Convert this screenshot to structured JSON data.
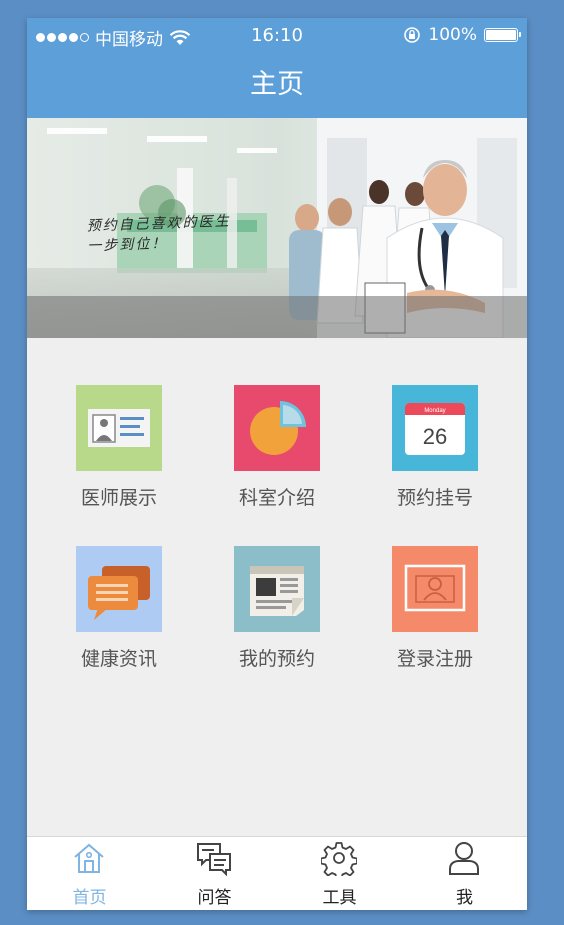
{
  "status_bar": {
    "carrier": "中国移动",
    "time": "16:10",
    "battery": "100%",
    "battery_level": 1.0,
    "signal_bars_filled": 4,
    "signal_bars_total": 5
  },
  "nav": {
    "title": "主页"
  },
  "banner": {
    "caption_line1": "预约自己喜欢的医生",
    "caption_line2": "一步到位！"
  },
  "grid": {
    "items": [
      {
        "label": "医师展示",
        "icon": "doctor-card-icon",
        "color": "#b9d98a"
      },
      {
        "label": "科室介绍",
        "icon": "pie-chart-icon",
        "color": "#e74a6d"
      },
      {
        "label": "预约挂号",
        "icon": "calendar-icon",
        "color": "#48b6d8",
        "calendar_month": "Monday",
        "calendar_day": "26"
      },
      {
        "label": "健康资讯",
        "icon": "chat-bubbles-icon",
        "color": "#aecbf4"
      },
      {
        "label": "我的预约",
        "icon": "newspaper-icon",
        "color": "#8cbec9"
      },
      {
        "label": "登录注册",
        "icon": "user-frame-icon",
        "color": "#f58a6a"
      }
    ]
  },
  "tabs": [
    {
      "label": "首页",
      "icon": "home-icon",
      "active": true
    },
    {
      "label": "问答",
      "icon": "qa-icon",
      "active": false
    },
    {
      "label": "工具",
      "icon": "gear-icon",
      "active": false
    },
    {
      "label": "我",
      "icon": "user-icon",
      "active": false
    }
  ],
  "colors": {
    "primary": "#5d9fd8",
    "background": "#efefef",
    "active_tab": "#7fb4e3"
  }
}
